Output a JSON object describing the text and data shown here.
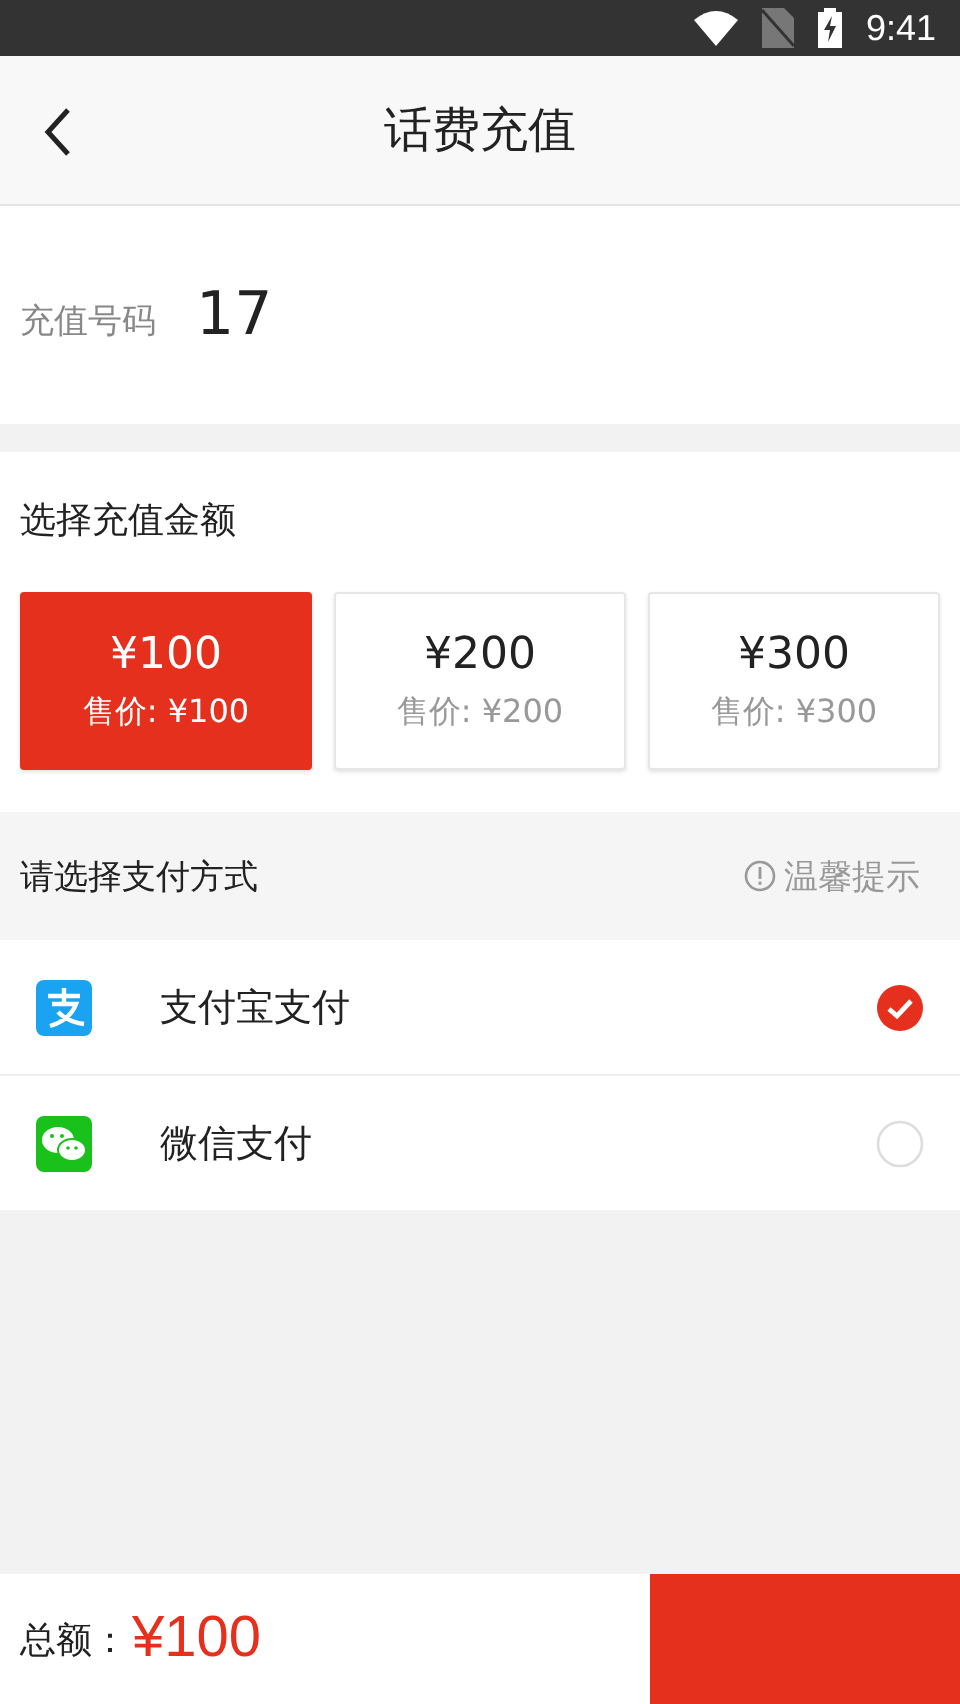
{
  "status_bar": {
    "time": "9:41"
  },
  "header": {
    "title": "话费充值"
  },
  "phone": {
    "label": "充值号码",
    "value": "17"
  },
  "amounts": {
    "title": "选择充值金额",
    "options": [
      {
        "amount": "¥100",
        "price": "售价: ¥100",
        "selected": true
      },
      {
        "amount": "¥200",
        "price": "售价: ¥200",
        "selected": false
      },
      {
        "amount": "¥300",
        "price": "售价: ¥300",
        "selected": false
      }
    ]
  },
  "payment": {
    "title": "请选择支付方式",
    "tip": "温馨提示",
    "methods": [
      {
        "kind": "alipay",
        "name": "支付宝支付",
        "selected": true
      },
      {
        "kind": "wechat",
        "name": "微信支付",
        "selected": false
      }
    ]
  },
  "footer": {
    "total_label": "总额：",
    "total": "¥100"
  }
}
